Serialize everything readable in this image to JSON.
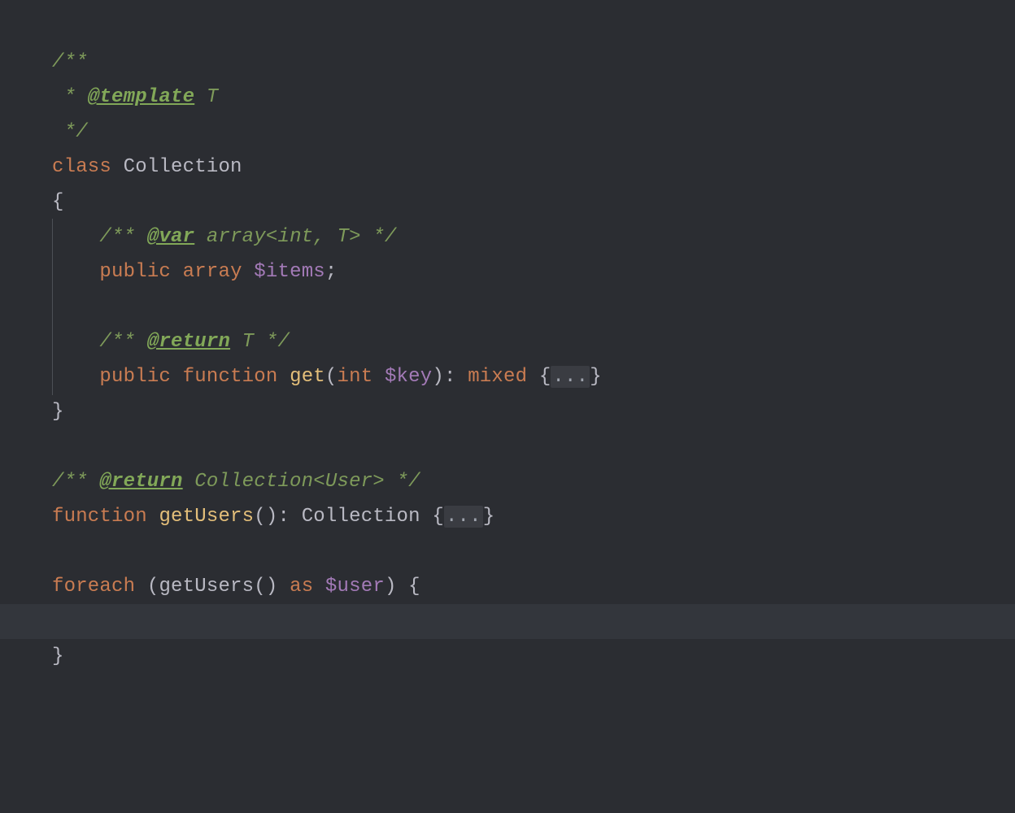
{
  "colors": {
    "bg": "#2b2d32",
    "bg_highlight": "#33363c",
    "comment": "#7E9A5A",
    "doc_tag": "#82a858",
    "keyword": "#c97c52",
    "func_name": "#e4bf7a",
    "type_purple": "#a37ab7",
    "fold_bg": "#3a3c42",
    "guide": "#4c4f55"
  },
  "fold": "...",
  "highlight_line": 16,
  "code": {
    "l1": {
      "open": "/**"
    },
    "l2": {
      "star": " * ",
      "tag": "@template",
      "rest": " T"
    },
    "l3": {
      "close": " */"
    },
    "l4": {
      "kw": "class",
      "sp": " ",
      "name": "Collection"
    },
    "l5": {
      "brace": "{"
    },
    "l6": {
      "indent": "    ",
      "open": "/** ",
      "tag": "@var",
      "rest": " array<int, T> ",
      "close": "*/"
    },
    "l7": {
      "indent": "    ",
      "kw": "public",
      "sp": " ",
      "type": "array",
      "sp2": " ",
      "var": "$items",
      "semi": ";"
    },
    "l8": {},
    "l9": {
      "indent": "    ",
      "open": "/** ",
      "tag": "@return",
      "rest": " T ",
      "close": "*/"
    },
    "l10": {
      "indent": "    ",
      "kw1": "public",
      "sp1": " ",
      "kw2": "function",
      "sp2": " ",
      "fn": "get",
      "po": "(",
      "ptype": "int",
      "sp3": " ",
      "pvar": "$key",
      "pc": ")",
      "colon": ": ",
      "rtype": "mixed",
      "sp4": " ",
      "bo": "{",
      "bc": "}"
    },
    "l11": {
      "brace": "}"
    },
    "l12": {},
    "l13": {
      "open": "/** ",
      "tag": "@return",
      "rest": " Collection<User> ",
      "close": "*/"
    },
    "l14": {
      "kw": "function",
      "sp": " ",
      "fn": "getUsers",
      "parens": "()",
      "colon": ": ",
      "rtype": "Collection",
      "sp2": " ",
      "bo": "{",
      "bc": "}"
    },
    "l15": {},
    "l16": {
      "kw": "foreach",
      "sp": " ",
      "po": "(",
      "fn": "getUsers",
      "parens": "()",
      "sp2": " ",
      "as": "as",
      "sp3": " ",
      "var": "$user",
      "pc": ")",
      "sp4": " ",
      "bo": "{"
    },
    "l17": {},
    "l18": {
      "brace": "}"
    }
  }
}
